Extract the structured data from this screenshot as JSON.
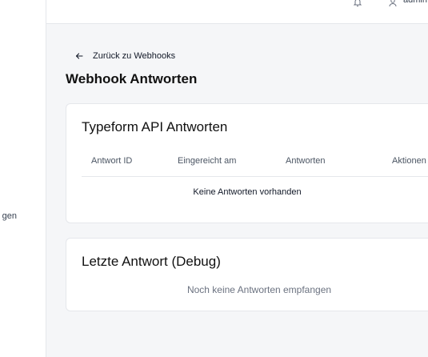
{
  "sidebar": {
    "partial_item_label": "gen"
  },
  "topbar": {
    "bell_icon": "bell-icon",
    "user_icon": "user-icon",
    "username": "admin"
  },
  "nav": {
    "back_label": "Zurück zu Webhooks",
    "back_icon": "arrow-left-icon"
  },
  "page": {
    "title": "Webhook Antworten"
  },
  "responses_card": {
    "title": "Typeform API Antworten",
    "columns": [
      "Antwort ID",
      "Eingereicht am",
      "Antworten",
      "Aktionen"
    ],
    "empty_text": "Keine Antworten vorhanden"
  },
  "debug_card": {
    "title": "Letzte Antwort (Debug)",
    "empty_text": "Noch keine Antworten empfangen"
  }
}
